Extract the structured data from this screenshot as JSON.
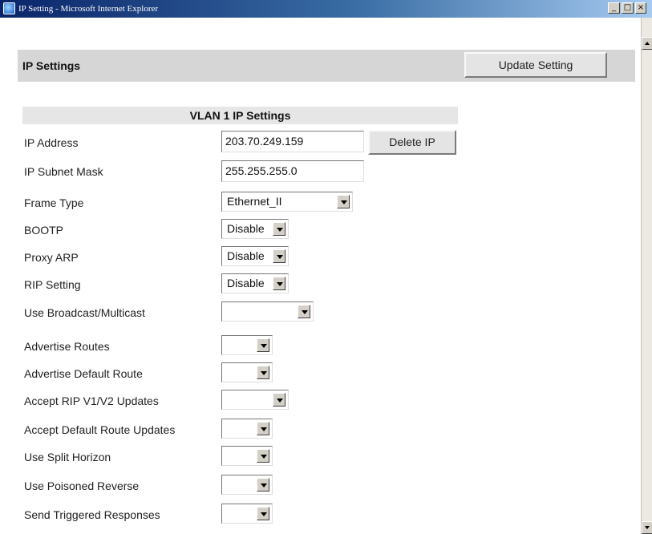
{
  "window": {
    "title": "IP Setting - Microsoft Internet Explorer",
    "minimize_glyph": "_",
    "maximize_glyph": "□",
    "close_glyph": "×"
  },
  "header": {
    "title": "IP Settings",
    "update_label": "Update Setting"
  },
  "section": {
    "title": "VLAN 1 IP Settings"
  },
  "fields": {
    "ip_address": {
      "label": "IP Address",
      "value": "203.70.249.159",
      "delete_label": "Delete IP"
    },
    "subnet_mask": {
      "label": "IP Subnet Mask",
      "value": "255.255.255.0"
    },
    "frame_type": {
      "label": "Frame Type",
      "value": "Ethernet_II"
    },
    "bootp": {
      "label": "BOOTP",
      "value": "Disable"
    },
    "proxy_arp": {
      "label": "Proxy ARP",
      "value": "Disable"
    },
    "rip_setting": {
      "label": "RIP Setting",
      "value": "Disable"
    },
    "broadcast_multicast": {
      "label": "Use Broadcast/Multicast",
      "value": ""
    },
    "advertise_routes": {
      "label": "Advertise Routes",
      "value": ""
    },
    "advertise_default_route": {
      "label": "Advertise Default Route",
      "value": ""
    },
    "accept_rip_updates": {
      "label": "Accept RIP V1/V2 Updates",
      "value": ""
    },
    "accept_default_route_updates": {
      "label": "Accept Default Route Updates",
      "value": ""
    },
    "split_horizon": {
      "label": "Use Split Horizon",
      "value": ""
    },
    "poisoned_reverse": {
      "label": "Use Poisoned Reverse",
      "value": ""
    },
    "triggered_responses": {
      "label": "Send Triggered Responses",
      "value": ""
    }
  },
  "icons": {
    "app": "ie-icon",
    "scroll_up": "scroll-up-arrow-icon",
    "scroll_down": "scroll-down-arrow-icon",
    "dropdown": "chevron-down-icon"
  },
  "colors": {
    "titlebar_start": "#0a246a",
    "titlebar_end": "#a6caf0",
    "header_bg": "#d6d6d6",
    "section_bg": "#e6e6e6"
  }
}
